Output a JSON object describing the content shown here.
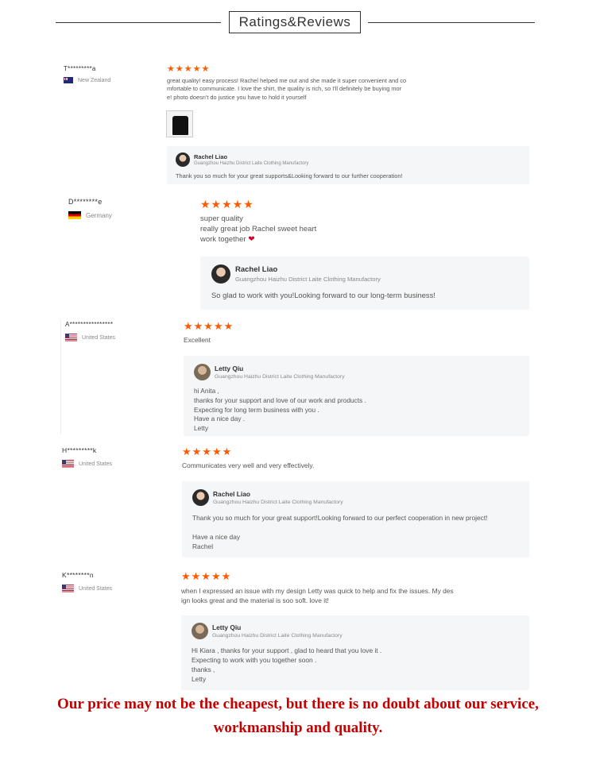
{
  "header": {
    "title": "Ratings&Reviews"
  },
  "reviews": [
    {
      "reviewer": "T*********a",
      "country": "New Zealand",
      "stars": "★★★★★",
      "comment": "great quality! easy process! Rachel helped me out and she made it super convenient and co\nmfortable to communicate. I love the shirt, the quality is rich, so I'll definitely be buying mor\ne! photo doesn't do justice you have to hold it yourself",
      "reply": {
        "name": "Rachel Liao",
        "company": "Guangzhou Haizhu District Laite Clothing Manufactory",
        "text": "Thank you so much for your great supports&Looking forward to our further cooperation!"
      }
    },
    {
      "reviewer": "D********e",
      "country": "Germany",
      "stars": "★★★★★",
      "comment": "super quality\nreally great job Rachel sweet heart\nwork together",
      "reply": {
        "name": "Rachel Liao",
        "company": "Guangzhou Haizhu District Laite Clothing Manufactory",
        "text": "So glad to work with you!Looking forward to our long-term business!"
      }
    },
    {
      "reviewer": "A****************",
      "country": "United States",
      "stars": "★★★★★",
      "comment": "Excellent",
      "reply": {
        "name": "Letty Qiu",
        "company": "Guangzhou Haizhu District Laite Clothing Manufactory",
        "text": "hi Anita ,\nthanks for your support and love of our work and products .\nExpecting for long term business with you .\nHave a nice day .\nLetty"
      }
    },
    {
      "reviewer": "H*********k",
      "country": "United States",
      "stars": "★★★★★",
      "comment": "Communicates very well and very effectively.",
      "reply": {
        "name": "Rachel Liao",
        "company": "Guangzhou Haizhu District Laite Clothing Manufactory",
        "text": "Thank you so much for your great support!Looking forward to our perfect cooperation in new project!\n\nHave a nice day\nRachel"
      }
    },
    {
      "reviewer": "K********n",
      "country": "United States",
      "stars": "★★★★★",
      "comment": "when I expressed an issue with my design Letty was quick to help and fix the issues. My des\nign looks great and the material is soo soft. love it!",
      "reply": {
        "name": "Letty Qiu",
        "company": "Guangzhou Haizhu District Laite Clothing Manufactory",
        "text": "Hi Kiara , thanks for your support , glad to heard that you love it .\nExpecting to work with you together soon .\nthanks ,\nLetty"
      }
    }
  ],
  "footer": {
    "line1": "Our price may not be the cheapest, but there is no doubt about our service,",
    "line2": "workmanship and quality."
  },
  "colors": {
    "stars": "#ff5a00",
    "footer": "#c40000",
    "reply_bg": "#f5f6f7"
  }
}
